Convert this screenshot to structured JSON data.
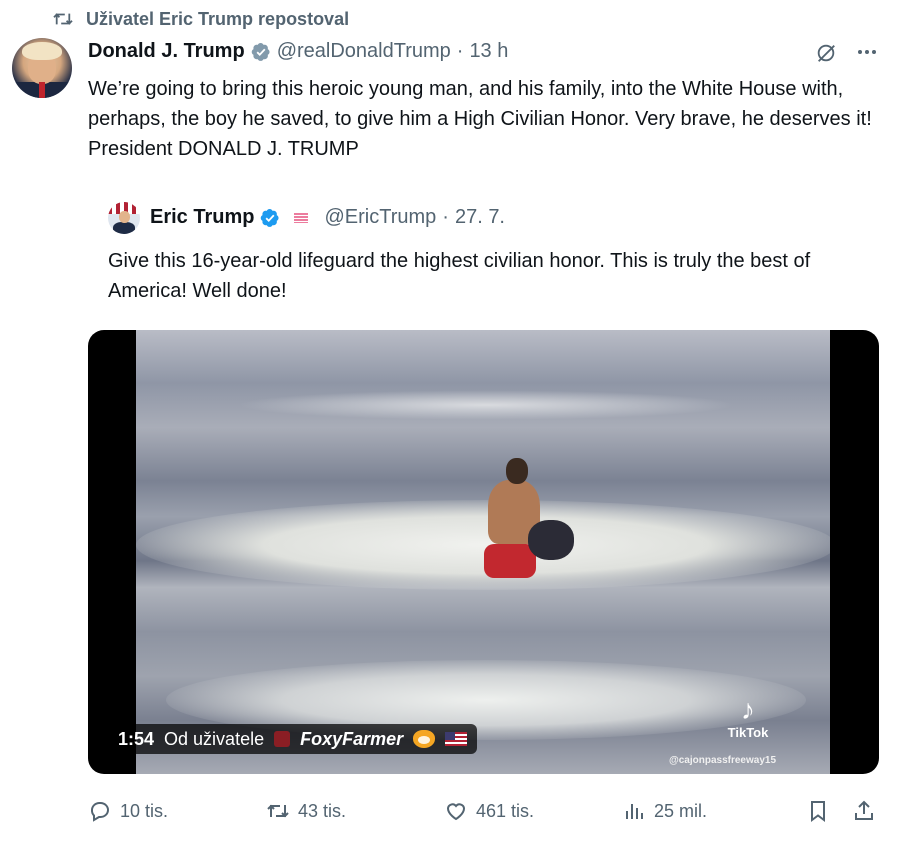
{
  "repost_banner": {
    "text": "Uživatel Eric Trump repostoval",
    "icon": "repost-icon"
  },
  "tweet": {
    "author_name": "Donald J. Trump",
    "handle": "@realDonaldTrump",
    "separator": "·",
    "time": "13 h",
    "verified_badge": "gray-verified-badge-icon",
    "text": "We’re going to bring this heroic young man, and his family, into the White House with, perhaps, the boy he saved, to give him a High Civilian Honor. Very brave, he deserves it! President DONALD J. TRUMP"
  },
  "quoted_tweet": {
    "author_name": "Eric Trump",
    "handle": "@EricTrump",
    "separator": "·",
    "date": "27. 7.",
    "verified_badge": "blue-verified-badge-icon",
    "text": "Give this 16-year-old lifeguard the highest civilian honor.  This is truly the best of America! Well done!",
    "video": {
      "duration": "1:54",
      "from_label": "Od uživatele",
      "source_user": "FoxyFarmer",
      "platform_logo_text": "TikTok",
      "watermark": "@cajonpassfreeway15"
    }
  },
  "actions": {
    "replies": "10 tis.",
    "reposts": "43 tis.",
    "likes": "461 tis.",
    "views": "25 mil."
  },
  "colors": {
    "text_primary": "#0f1419",
    "text_secondary": "#536471",
    "verified_blue": "#1d9bf0",
    "verified_gray": "#829aab"
  }
}
